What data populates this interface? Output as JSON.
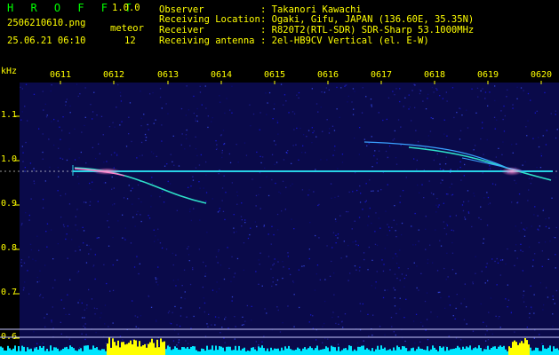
{
  "header": {
    "app_name": "H R O F F T",
    "version": "1.0.0",
    "filename": "2506210610.png",
    "event_label": "meteor",
    "datetime": "25.06.21 06:10",
    "event_count": "12",
    "info": [
      {
        "label": "Observer",
        "value": ": Takanori Kawachi"
      },
      {
        "label": "Receiving Location",
        "value": ": Ogaki, Gifu, JAPAN (136.60E, 35.35N)"
      },
      {
        "label": "Receiver",
        "value": ": R820T2(RTL-SDR) SDR-Sharp 53.1000MHz"
      },
      {
        "label": "Receiving antenna",
        "value": ": 2el-HB9CV Vertical (el. E-W)"
      }
    ]
  },
  "chart_data": {
    "type": "heatmap",
    "ylabel": "kHz",
    "y_ticks": [
      "1.1",
      "1.0",
      "0.9",
      "0.8",
      "0.7",
      "0.6"
    ],
    "x_ticks": [
      "0611",
      "0612",
      "0613",
      "0614",
      "0615",
      "0616",
      "0617",
      "0618",
      "0619",
      "0620"
    ]
  },
  "colors": {
    "background": "#000000",
    "spectrogram_bg": "#0a0a4a",
    "text_header": "#00ff00",
    "text_axis": "#ffff00",
    "carrier": "#28d2e6",
    "meteor_echo": "#ff78c8",
    "histogram": "#00e6ff",
    "histogram_peak": "#ffff00"
  }
}
